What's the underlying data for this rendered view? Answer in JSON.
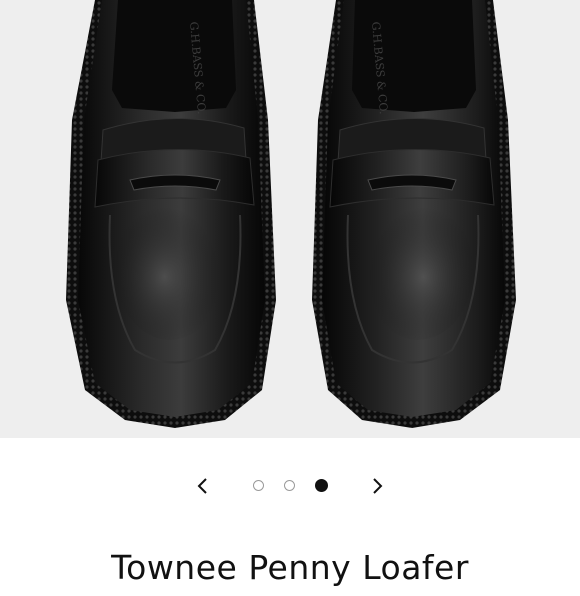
{
  "product": {
    "title": "Townee Penny Loafer",
    "image": {
      "description_icon": "penny-loafer-pair-image",
      "background": "#eeeeee",
      "shoe_color": "#141414",
      "sole_detail_color": "#2a2a2a"
    },
    "insole_brand_left": "G.H.BASS & CO.",
    "insole_brand_right": "G.H.BASS & CO."
  },
  "carousel": {
    "prev_icon": "chevron-left-icon",
    "next_icon": "chevron-right-icon",
    "slide_count": 3,
    "active_index": 3
  }
}
